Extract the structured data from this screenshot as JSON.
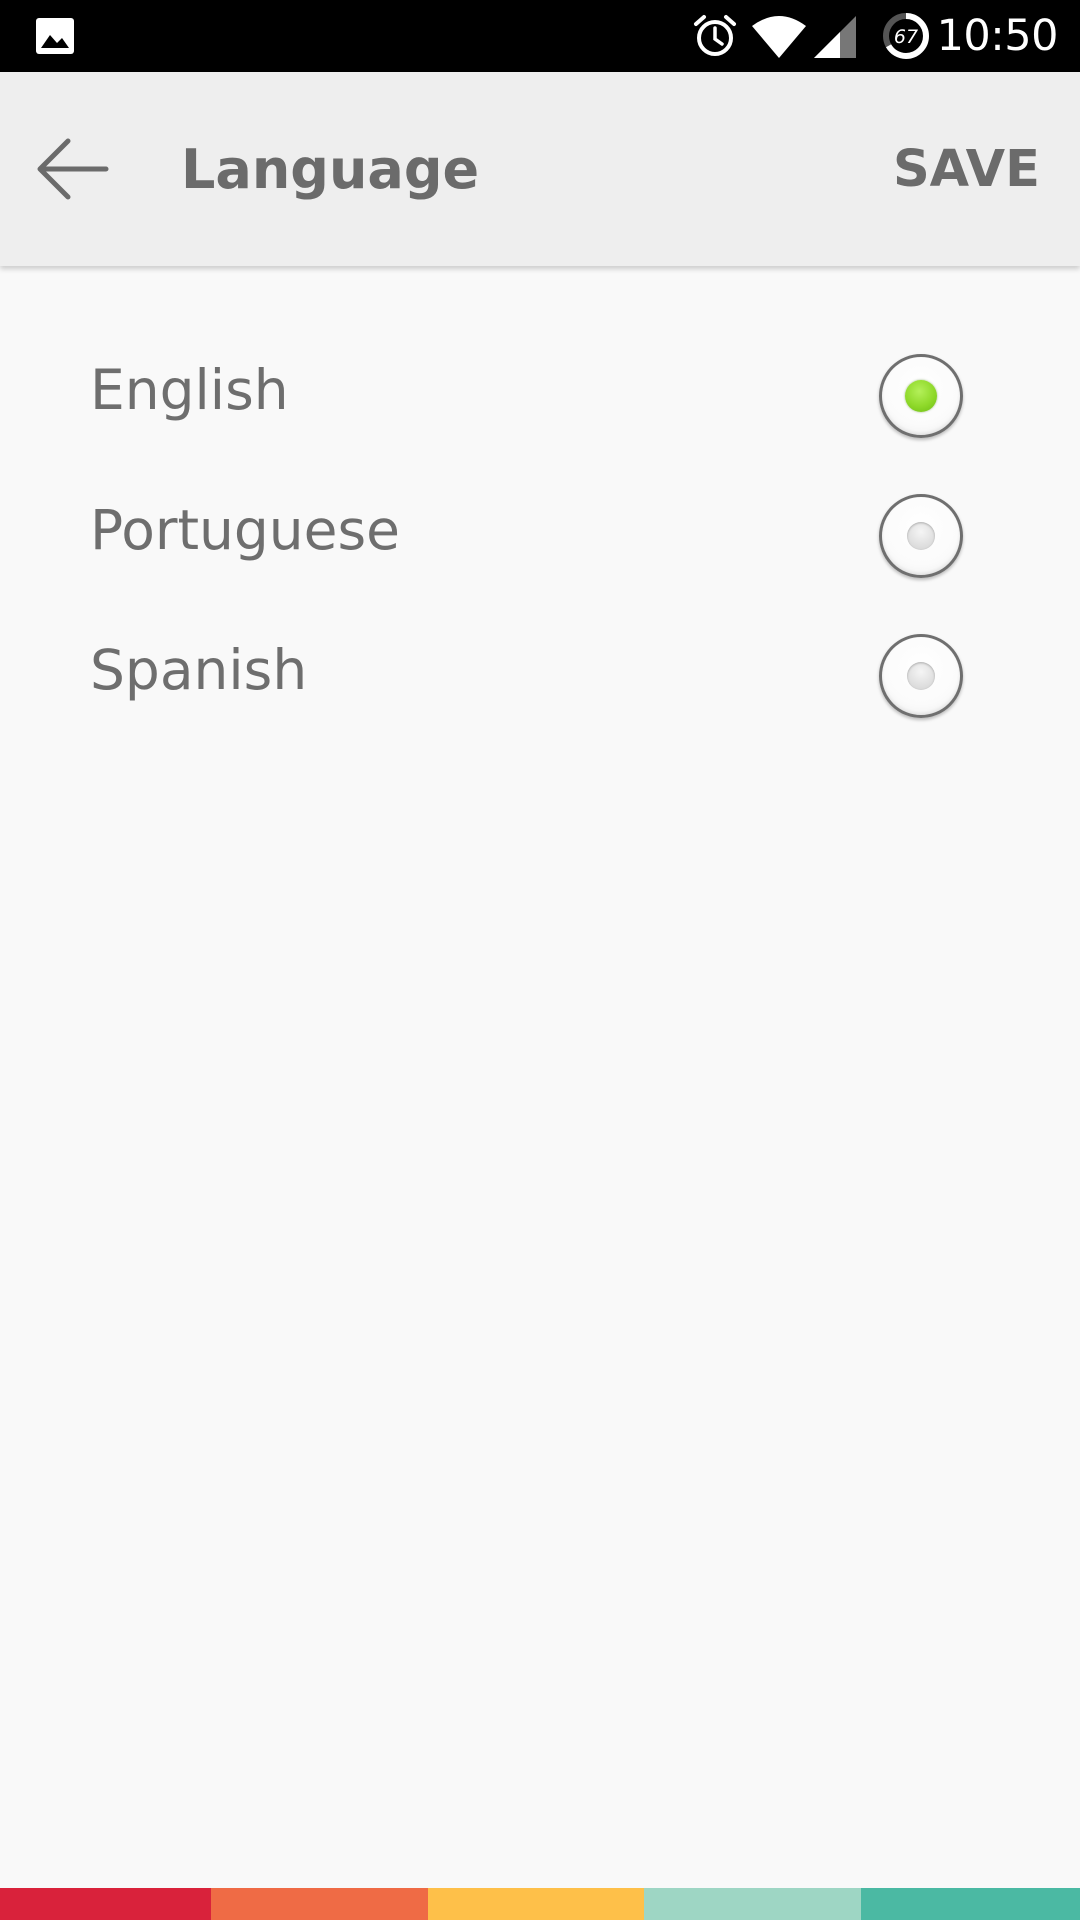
{
  "status_bar": {
    "time": "10:50",
    "battery_level": "67",
    "icons": [
      "gallery-icon",
      "alarm-icon",
      "wifi-icon",
      "signal-icon",
      "battery-icon"
    ]
  },
  "app_bar": {
    "back_icon": "arrow-left-icon",
    "title": "Language",
    "save_label": "SAVE"
  },
  "languages": [
    {
      "label": "English",
      "selected": true
    },
    {
      "label": "Portuguese",
      "selected": false
    },
    {
      "label": "Spanish",
      "selected": false
    }
  ],
  "colors": {
    "background": "#f9f9f9",
    "app_bar": "#eeeeee",
    "text": "#6b6b6b",
    "radio_selected": "#8fd92a",
    "strip": [
      "#d9223b",
      "#ef6b45",
      "#fec049",
      "#9ed6c4",
      "#4bb9a3"
    ]
  }
}
